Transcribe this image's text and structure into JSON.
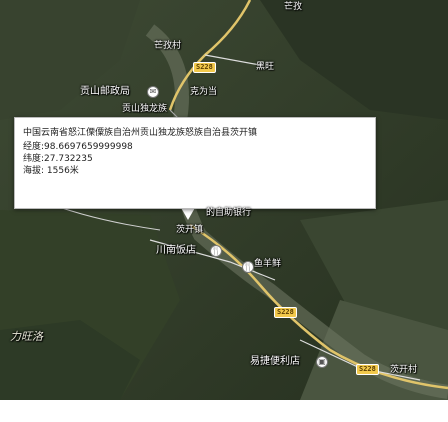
{
  "map": {
    "labels": {
      "top_fragment": "芒孜",
      "mangzi_village": "芒孜村",
      "heiwang": "黑旺",
      "gongshan_post_office": "贡山邮政局",
      "keshou": "克为当",
      "gongshan_dulong": "贡山独龙族",
      "bank_fragment": "的自助银行",
      "chakai_town": "茨开镇",
      "chuannan_restaurant": "川南饭店",
      "yuyangxian": "鱼羊鲜",
      "liwangluo": "力旺洛",
      "yijie_store": "易捷便利店",
      "chakai_village": "茨开村"
    },
    "road_shields": {
      "s228_top": "S228",
      "s228_mid": "S228",
      "s228_bottom": "S228"
    }
  },
  "popup": {
    "address": "中国云南省怒江傈僳族自治州贡山独龙族怒族自治县茨开镇",
    "longitude": "经度:98.6697659999998",
    "latitude": "纬度:27.732235",
    "altitude": "海拔: 1556米"
  }
}
